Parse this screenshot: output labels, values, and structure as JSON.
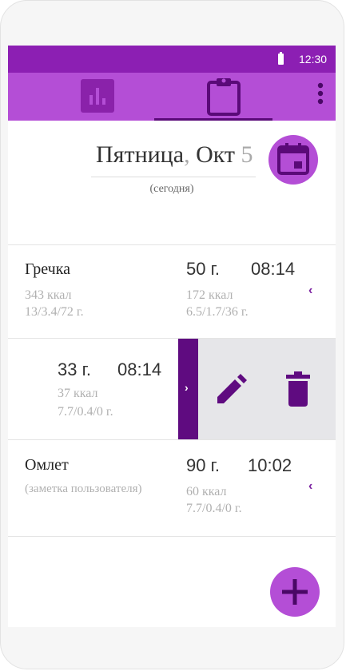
{
  "status_bar": {
    "time": "12:30"
  },
  "toolbar": {
    "tabs": [
      {
        "icon": "bar-chart-icon"
      },
      {
        "icon": "clipboard-icon"
      }
    ],
    "menu_icon": "more-vertical-icon"
  },
  "date": {
    "weekday": "Пятница",
    "separator": ",",
    "month": "Окт",
    "day": "5",
    "today_label": "(сегодня)"
  },
  "entries": [
    {
      "name": "Гречка",
      "kcal": "343 ккал",
      "macros": "13/3.4/72 г.",
      "amount": "50 г.",
      "time": "08:14",
      "portion_kcal": "172 ккал",
      "portion_macros": "6.5/1.7/36 г."
    },
    {
      "name": "",
      "amount": "33 г.",
      "time": "08:14",
      "portion_kcal": "37 ккал",
      "portion_macros": "7.7/0.4/0 г."
    },
    {
      "name": "Омлет",
      "note": "(заметка пользователя)",
      "amount": "90 г.",
      "time": "10:02",
      "portion_kcal": "60 ккал",
      "portion_macros": "7.7/0.4/0 г."
    }
  ],
  "colors": {
    "status_bar": "#8c1fb3",
    "toolbar": "#b44ed6",
    "accent_dark": "#5f0b80",
    "swipe_bg": "#e6e6e9"
  }
}
